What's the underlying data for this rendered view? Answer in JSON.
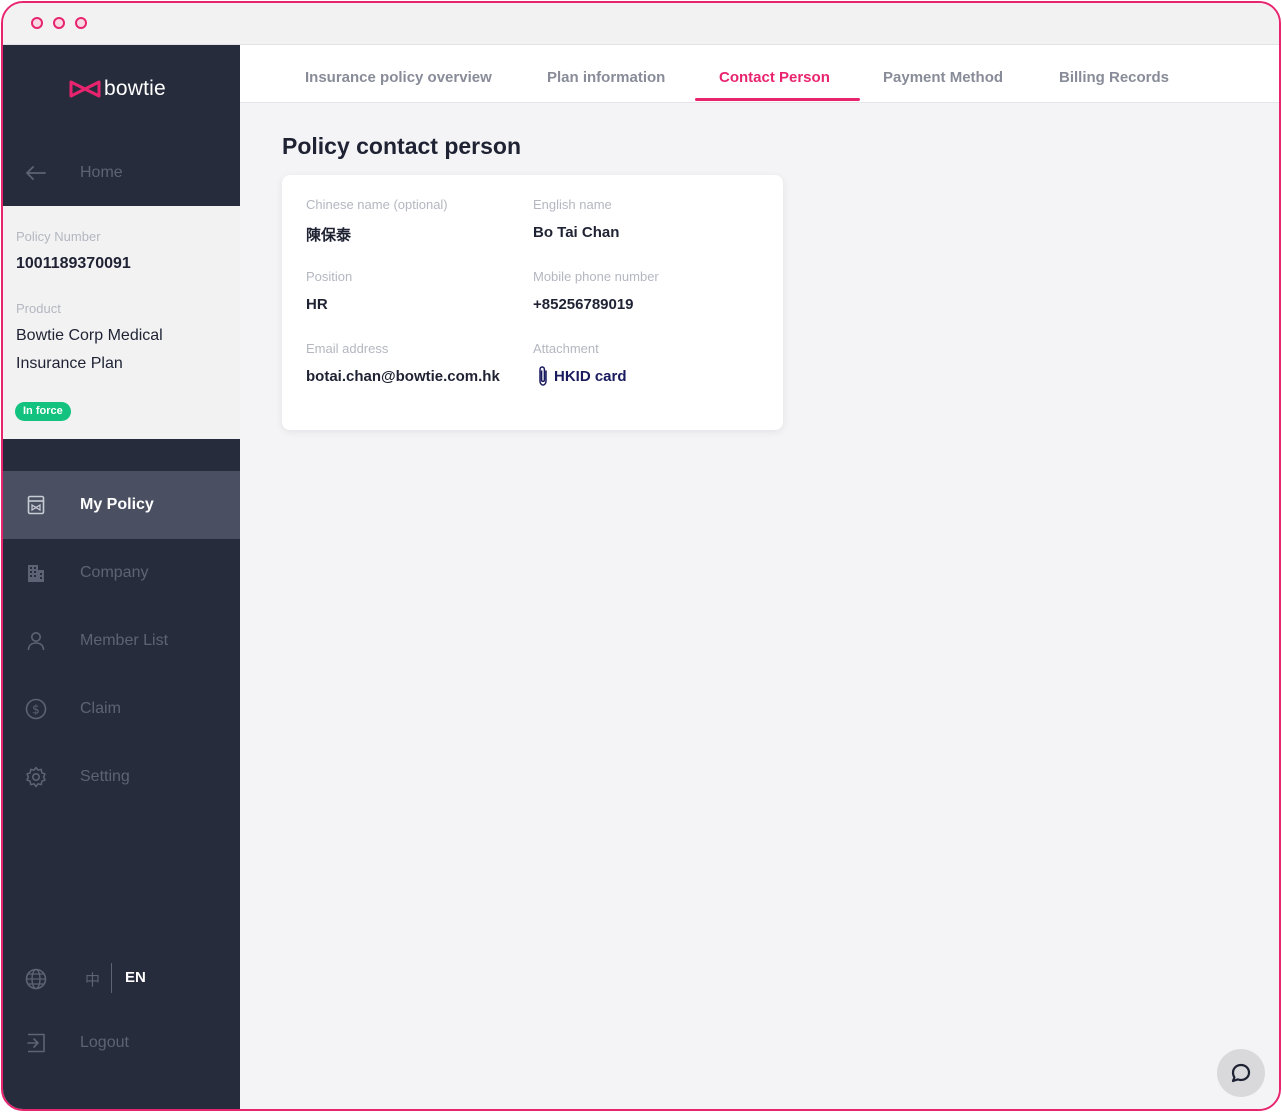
{
  "colors": {
    "accent": "#e8246f",
    "sidebar": "#272c3c",
    "status_green": "#12c27e"
  },
  "brand": {
    "name": "bowtie"
  },
  "sidebar": {
    "home_label": "Home",
    "policy": {
      "number_label": "Policy Number",
      "number": "1001189370091",
      "product_label": "Product",
      "product": "Bowtie Corp Medical Insurance Plan",
      "status": "In force"
    },
    "nav": [
      {
        "label": "My Policy",
        "icon": "policy-icon",
        "active": true
      },
      {
        "label": "Company",
        "icon": "building-icon"
      },
      {
        "label": "Member List",
        "icon": "user-icon"
      },
      {
        "label": "Claim",
        "icon": "dollar-icon"
      },
      {
        "label": "Setting",
        "icon": "gear-icon"
      }
    ],
    "language": {
      "zh": "中",
      "en": "EN",
      "selected": "EN"
    },
    "logout_label": "Logout"
  },
  "tabs": [
    {
      "label": "Insurance policy overview"
    },
    {
      "label": "Plan information"
    },
    {
      "label": "Contact Person",
      "active": true
    },
    {
      "label": "Payment Method"
    },
    {
      "label": "Billing Records"
    }
  ],
  "main": {
    "title": "Policy contact person",
    "fields": {
      "chinese_name": {
        "label": "Chinese name (optional)",
        "value": "陳保泰"
      },
      "english_name": {
        "label": "English name",
        "value": "Bo Tai Chan"
      },
      "position": {
        "label": "Position",
        "value": "HR"
      },
      "mobile": {
        "label": "Mobile phone number",
        "value": "+85256789019"
      },
      "email": {
        "label": "Email address",
        "value": "botai.chan@bowtie.com.hk"
      },
      "attachment": {
        "label": "Attachment",
        "value": "HKID card",
        "icon": "paperclip-icon"
      }
    }
  }
}
